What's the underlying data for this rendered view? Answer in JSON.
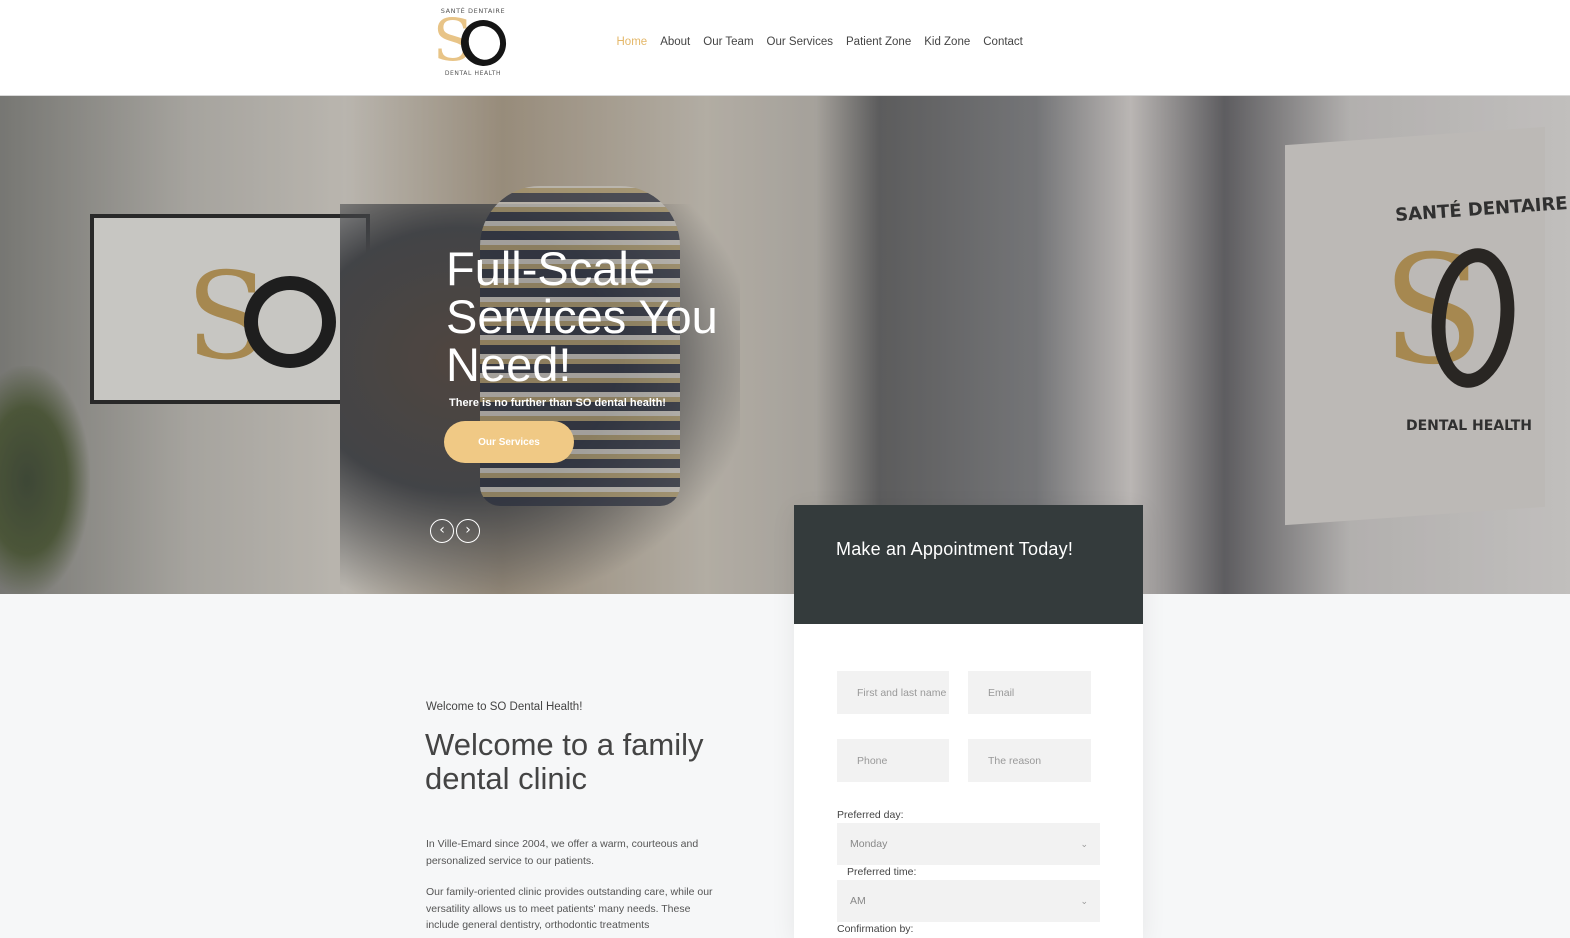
{
  "brand": {
    "logo_top": "SANTÉ DENTAIRE",
    "logo_main": "SO",
    "logo_bottom": "DENTAL HEALTH",
    "accent_color": "#e4b768",
    "dark_color": "#343b3c"
  },
  "nav": {
    "items": [
      {
        "label": "Home",
        "active": true
      },
      {
        "label": "About"
      },
      {
        "label": "Our Team"
      },
      {
        "label": "Our Services"
      },
      {
        "label": "Patient Zone"
      },
      {
        "label": "Kid Zone"
      },
      {
        "label": "Contact"
      }
    ]
  },
  "hero": {
    "title": "Full-Scale Services You Need!",
    "subtitle": "There is no further than SO dental health!",
    "button_label": "Our Services",
    "prev_icon": "‹",
    "next_icon": "›",
    "wall_sign_top": "SANTÉ DENTAIRE",
    "wall_sign_bottom": "DENTAL HEALTH"
  },
  "appointment": {
    "title": "Make an Appointment Today!",
    "name_placeholder": "First and last name",
    "email_placeholder": "Email",
    "phone_placeholder": "Phone",
    "reason_placeholder": "The reason",
    "preferred_day_label": "Preferred day:",
    "preferred_day_value": "Monday",
    "preferred_time_label": "Preferred time:",
    "preferred_time_value": "AM",
    "confirmation_label": "Confirmation by:"
  },
  "welcome": {
    "kicker": "Welcome to SO Dental Health!",
    "title": "Welcome to a family dental clinic",
    "paragraph1": "In Ville-Emard since 2004, we offer a warm, courteous and personalized service to our patients.",
    "paragraph2": "Our family-oriented clinic provides outstanding care, while our versatility allows us to meet patients' many needs. These include general dentistry, orthodontic treatments"
  }
}
